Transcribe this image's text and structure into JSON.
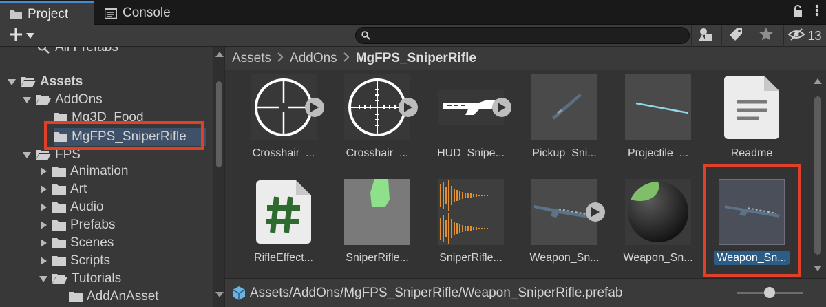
{
  "tabs": {
    "project_label": "Project",
    "console_label": "Console"
  },
  "toolbar": {
    "create_label": "+",
    "search_placeholder": "",
    "hidden_count": "13"
  },
  "tree": {
    "partial_top": "All Prefabs",
    "items": [
      {
        "label": "Assets",
        "depth": 0,
        "expanded": true,
        "bold": true
      },
      {
        "label": "AddOns",
        "depth": 1,
        "expanded": true
      },
      {
        "label": "Mg3D_Food",
        "depth": 2,
        "expanded": false,
        "leaf": true
      },
      {
        "label": "MgFPS_SniperRifle",
        "depth": 2,
        "expanded": false,
        "leaf": true,
        "highlighted": true
      },
      {
        "label": "FPS",
        "depth": 1,
        "expanded": true
      },
      {
        "label": "Animation",
        "depth": 2,
        "expanded": false
      },
      {
        "label": "Art",
        "depth": 2,
        "expanded": false
      },
      {
        "label": "Audio",
        "depth": 2,
        "expanded": false
      },
      {
        "label": "Prefabs",
        "depth": 2,
        "expanded": false
      },
      {
        "label": "Scenes",
        "depth": 2,
        "expanded": false
      },
      {
        "label": "Scripts",
        "depth": 2,
        "expanded": false
      },
      {
        "label": "Tutorials",
        "depth": 2,
        "expanded": true
      },
      {
        "label": "AddAnAsset",
        "depth": 3,
        "expanded": false,
        "leaf": true
      }
    ]
  },
  "breadcrumb": [
    "Assets",
    "AddOns",
    "MgFPS_SniperRifle"
  ],
  "assets": [
    {
      "label": "Crosshair_...",
      "kind": "crosshair-circle-icon",
      "play": true
    },
    {
      "label": "Crosshair_...",
      "kind": "crosshair-scope-icon",
      "play": true
    },
    {
      "label": "HUD_Snipe...",
      "kind": "hud-rifle-icon",
      "play": true
    },
    {
      "label": "Pickup_Sni...",
      "kind": "rifle-pickup-icon",
      "play": false
    },
    {
      "label": "Projectile_...",
      "kind": "projectile-icon",
      "play": false
    },
    {
      "label": "Readme",
      "kind": "document-icon",
      "play": false
    },
    {
      "label": "RifleEffect...",
      "kind": "script-hash-icon",
      "play": false
    },
    {
      "label": "SniperRifle...",
      "kind": "texture-icon",
      "play": false
    },
    {
      "label": "SniperRifle...",
      "kind": "audio-waveform-icon",
      "play": false
    },
    {
      "label": "Weapon_Sn...",
      "kind": "rifle-model-icon",
      "play": true
    },
    {
      "label": "Weapon_Sn...",
      "kind": "material-sphere-icon",
      "play": false
    },
    {
      "label": "Weapon_Sn...",
      "kind": "rifle-prefab-icon",
      "play": false,
      "selected": true
    }
  ],
  "status": {
    "path": "Assets/AddOns/MgFPS_SniperRifle/Weapon_SniperRifle.prefab",
    "zoom_level": 0.5
  },
  "colors": {
    "highlight_box": "#e0402a",
    "selection": "#2c5d87",
    "tab_accent": "#4a8ad4"
  }
}
